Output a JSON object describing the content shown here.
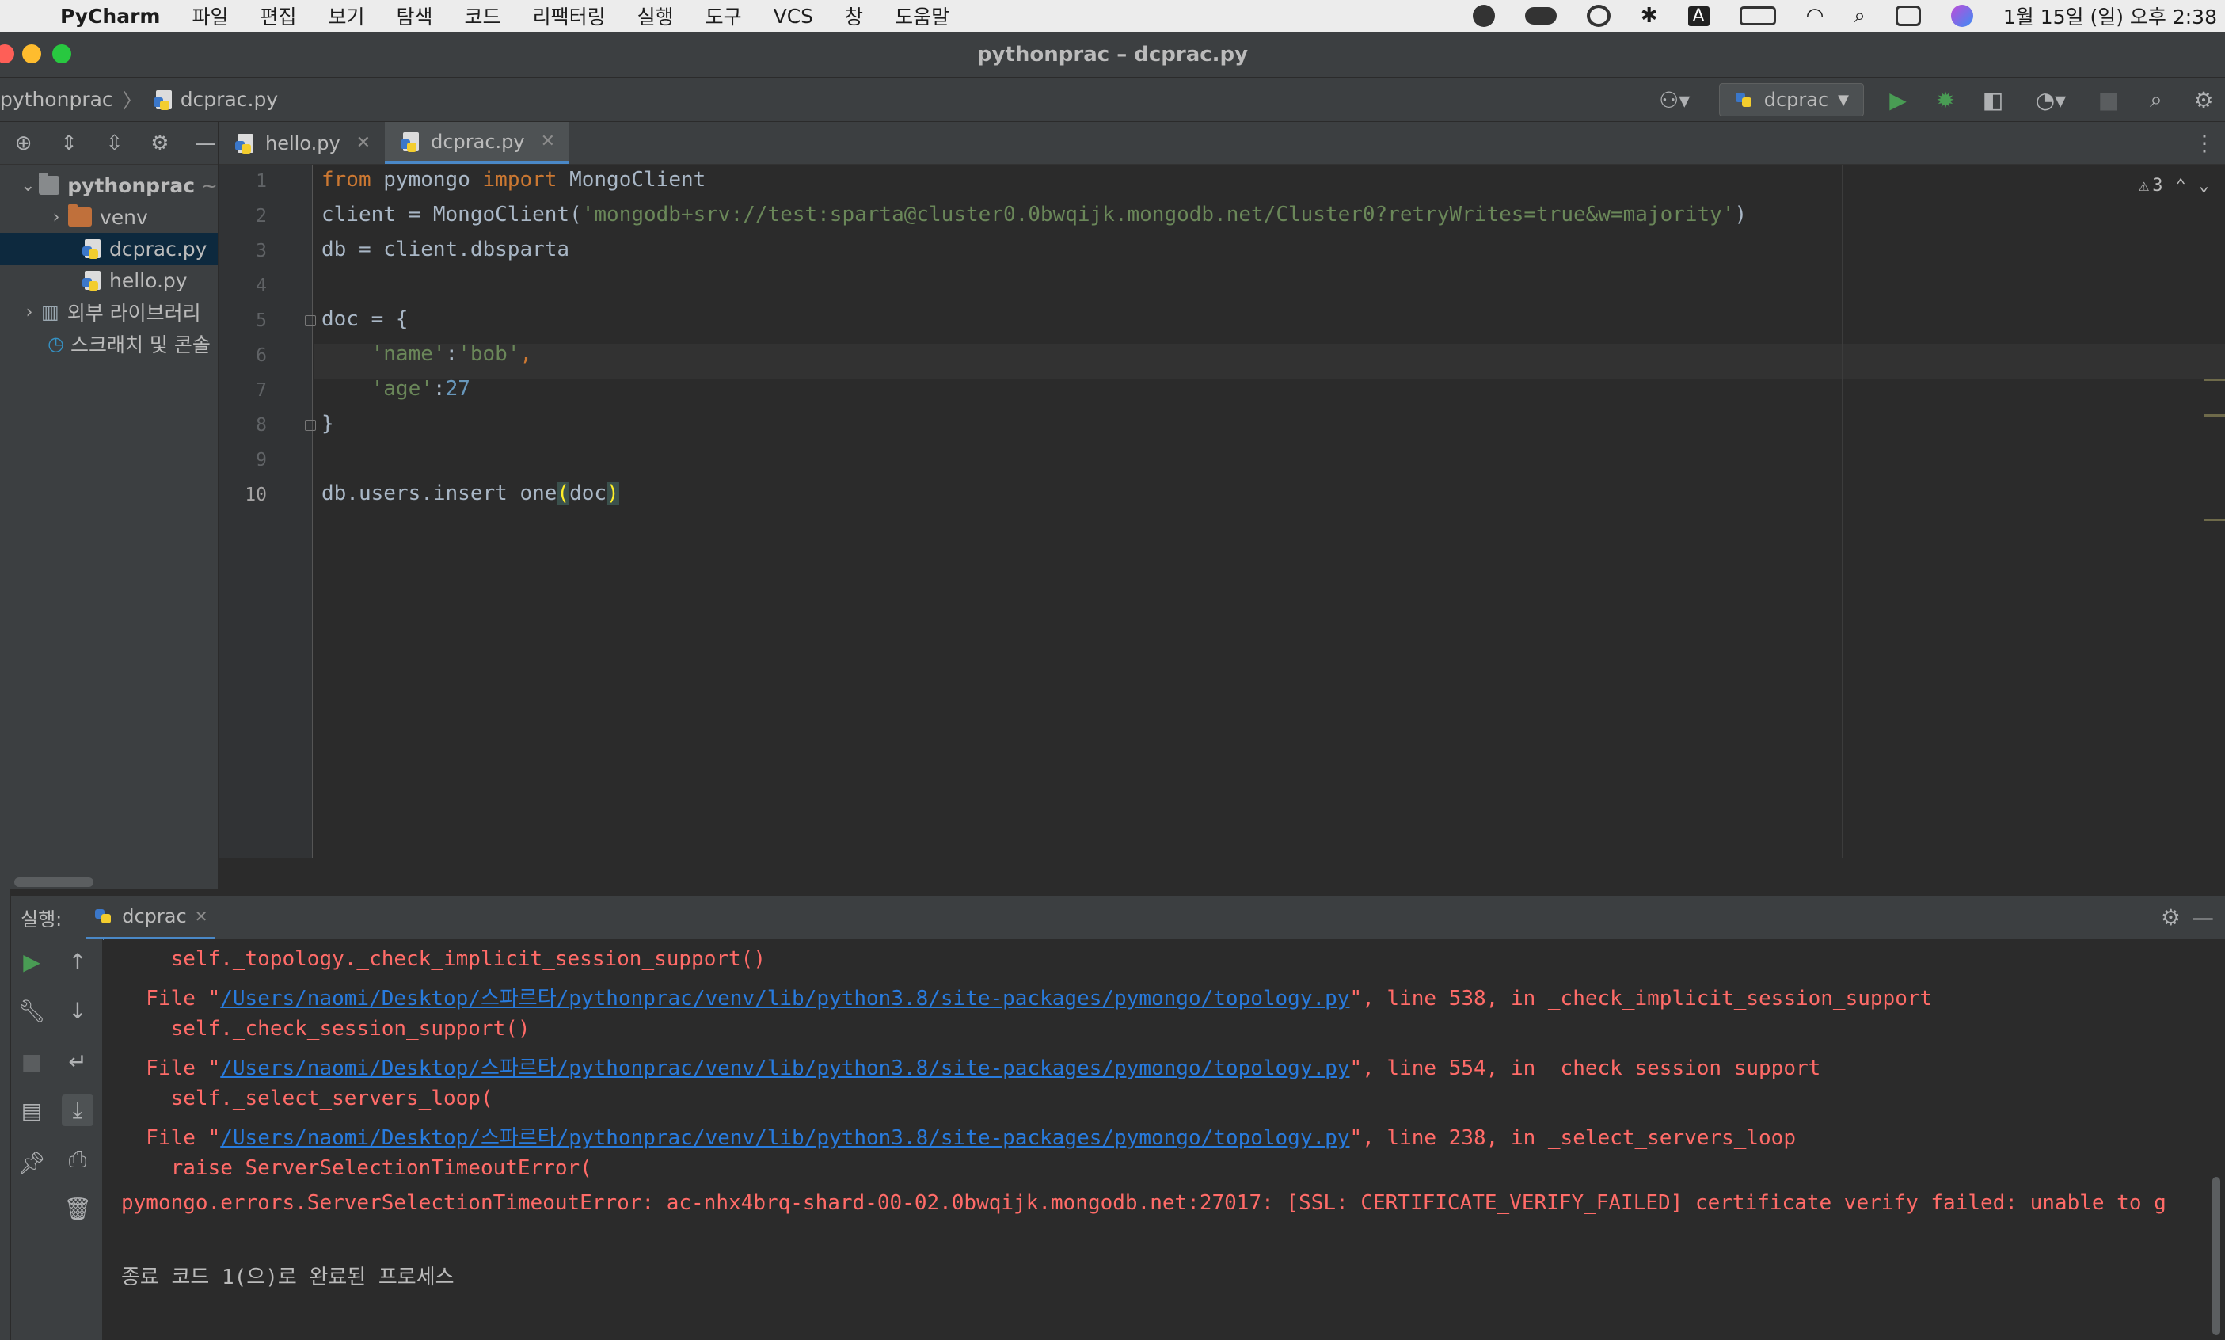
{
  "menubar": {
    "app_name": "PyCharm",
    "items": [
      "파일",
      "편집",
      "보기",
      "탐색",
      "코드",
      "리팩터링",
      "실행",
      "도구",
      "VCS",
      "창",
      "도움말"
    ],
    "clock": "1월 15일 (일) 오후 2:38",
    "tray_badge": "A"
  },
  "window": {
    "title": "pythonprac – dcprac.py"
  },
  "navbar": {
    "project": "pythonprac",
    "file": "dcprac.py",
    "run_config": "dcprac"
  },
  "project_panel": {
    "root": "pythonprac",
    "root_suffix": "~",
    "items": [
      {
        "label": "venv"
      },
      {
        "label": "dcprac.py"
      },
      {
        "label": "hello.py"
      },
      {
        "label": "외부 라이브러리"
      },
      {
        "label": "스크래치 및 콘솔"
      }
    ]
  },
  "tabs": [
    {
      "label": "hello.py",
      "close": "✕"
    },
    {
      "label": "dcprac.py",
      "close": "✕"
    }
  ],
  "editor": {
    "line_numbers": [
      "1",
      "2",
      "3",
      "4",
      "5",
      "6",
      "7",
      "8",
      "9",
      "10"
    ],
    "warning_count": "3",
    "code": {
      "l1_kw1": "from",
      "l1_mod": " pymongo ",
      "l1_kw2": "import",
      "l1_rest": " MongoClient",
      "l2_pre": "client = MongoClient(",
      "l2_str": "'mongodb+srv://test:sparta@cluster0.0bwqijk.mongodb.net/Cluster0?retryWrites=true&w=majority'",
      "l2_post": ")",
      "l3": "db = client.dbsparta",
      "l5": "doc = {",
      "l6_str1": "'name'",
      "l6_colon": ":",
      "l6_str2": "'bob'",
      "l6_comma": ",",
      "l7_str": "'age'",
      "l7_colon": ":",
      "l7_num": "27",
      "l8": "}",
      "l10_pre": "db.users.insert_one",
      "l10_open": "(",
      "l10_arg": "doc",
      "l10_close": ")"
    }
  },
  "run": {
    "label": "실행:",
    "tab": "dcprac",
    "close": "✕",
    "console": {
      "l1": "    self._topology._check_implicit_session_support()",
      "l2_pre": "  File \"",
      "l2_link": "/Users/naomi/Desktop/스파르타/pythonprac/venv/lib/python3.8/site-packages/pymongo/topology.py",
      "l2_post": "\", line 538, in _check_implicit_session_support",
      "l3": "    self._check_session_support()",
      "l4_pre": "  File \"",
      "l4_link": "/Users/naomi/Desktop/스파르타/pythonprac/venv/lib/python3.8/site-packages/pymongo/topology.py",
      "l4_post": "\", line 554, in _check_session_support",
      "l5": "    self._select_servers_loop(",
      "l6_pre": "  File \"",
      "l6_link": "/Users/naomi/Desktop/스파르타/pythonprac/venv/lib/python3.8/site-packages/pymongo/topology.py",
      "l6_post": "\", line 238, in _select_servers_loop",
      "l7": "    raise ServerSelectionTimeoutError(",
      "l8": "pymongo.errors.ServerSelectionTimeoutError: ac-nhx4brq-shard-00-02.0bwqijk.mongodb.net:27017: [SSL: CERTIFICATE_VERIFY_FAILED] certificate verify failed: unable to g",
      "l9": "종료 코드 1(으)로 완료된 프로세스"
    }
  },
  "colors": {
    "accent": "#4a88c7",
    "error_text": "#ff6b68",
    "link": "#287bde",
    "keyword": "#cc7832",
    "string": "#6a8759",
    "number": "#6897bb"
  }
}
